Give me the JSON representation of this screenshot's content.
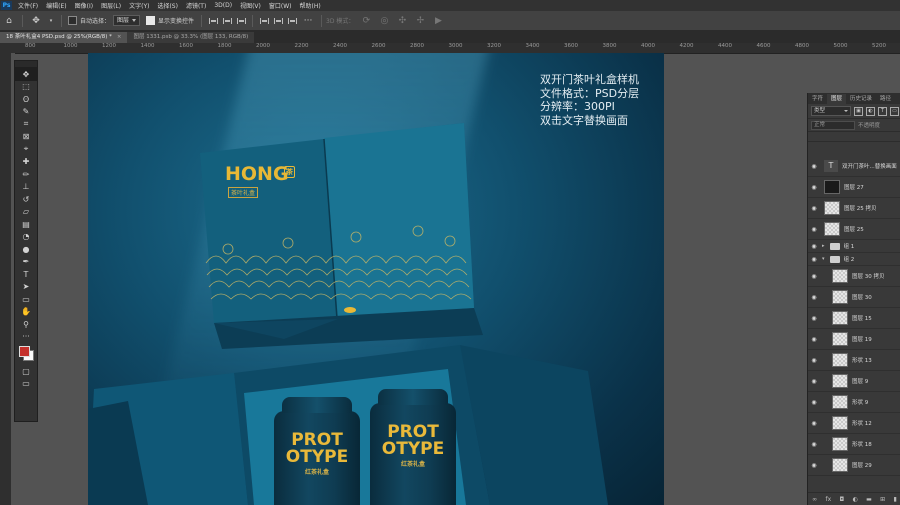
{
  "menubar": {
    "logo": "Ps",
    "items": [
      "文件(F)",
      "编辑(E)",
      "图像(I)",
      "图层(L)",
      "文字(Y)",
      "选择(S)",
      "滤镜(T)",
      "3D(D)",
      "视图(V)",
      "窗口(W)",
      "帮助(H)"
    ]
  },
  "options": {
    "auto_select_label": "自动选择：",
    "target_select": "图层",
    "show_transform_label": "显示变换控件",
    "mode_3d_label": "3D 模式："
  },
  "tabs": [
    {
      "label": "18 茶叶礼盒4 PSD.psd @ 25%(RGB/8) *",
      "close": "×"
    },
    {
      "label": "图层 1331.psb @ 33.3% (图层 133, RGB/8)",
      "close": ""
    }
  ],
  "ruler": {
    "ticks": [
      "800",
      "1000",
      "1200",
      "1400",
      "1600",
      "1800",
      "2000",
      "2200",
      "2400",
      "2600",
      "2800",
      "3000",
      "3200",
      "3400",
      "3600",
      "3800",
      "4000",
      "4200",
      "4400",
      "4600",
      "4800",
      "5000",
      "5200"
    ]
  },
  "toolbar": {
    "tools": [
      "move-tool",
      "marquee-tool",
      "lasso-tool",
      "quick-select-tool",
      "crop-tool",
      "frame-tool",
      "eyedropper-tool",
      "healing-tool",
      "brush-tool",
      "stamp-tool",
      "history-brush-tool",
      "eraser-tool",
      "gradient-tool",
      "blur-tool",
      "dodge-tool",
      "pen-tool",
      "type-tool",
      "path-select-tool",
      "rectangle-tool",
      "hand-tool",
      "zoom-tool",
      "more-tools"
    ],
    "foreground_color": "#c4302b",
    "background_color": "#fafafa"
  },
  "canvas": {
    "info_lines": [
      "双开门茶叶礼盒样机",
      "文件格式：PSD分层",
      "分辨率：300PI",
      "双击文字替换画面"
    ],
    "box_brand": "HONG",
    "box_badge": "茶",
    "box_subbrand": "茶叶礼盒",
    "can_line1": "PROT",
    "can_line2": "OTYPE",
    "can_badge": "茶",
    "can_subtext": "红茶礼盒",
    "accent_color": "#e8b836",
    "bg_color": "#0e4b66"
  },
  "layers_panel": {
    "tabs": [
      "字符",
      "图层",
      "历史记录",
      "路径"
    ],
    "filter_kind": "类型",
    "blend_mode": "正常",
    "opacity_label": "不透明度",
    "layers": [
      {
        "name": "双开门茶叶...替换画面",
        "thumb": "text",
        "type": "layer"
      },
      {
        "name": "图层 27",
        "thumb": "dark",
        "type": "layer"
      },
      {
        "name": "图层 25 拷贝",
        "thumb": "checker",
        "type": "layer"
      },
      {
        "name": "图层 25",
        "thumb": "checker",
        "type": "layer"
      },
      {
        "name": "组 1",
        "thumb": "folder",
        "type": "group"
      },
      {
        "name": "组 2",
        "thumb": "folder",
        "type": "group"
      },
      {
        "name": "图层 30 拷贝",
        "thumb": "checker",
        "type": "layer"
      },
      {
        "name": "图层 30",
        "thumb": "checker",
        "type": "layer"
      },
      {
        "name": "图层 15",
        "thumb": "checker",
        "type": "layer"
      },
      {
        "name": "图层 19",
        "thumb": "checker",
        "type": "layer"
      },
      {
        "name": "形状 13",
        "thumb": "checker",
        "type": "layer"
      },
      {
        "name": "图层 9",
        "thumb": "checker",
        "type": "layer"
      },
      {
        "name": "形状 9",
        "thumb": "checker",
        "type": "layer"
      },
      {
        "name": "形状 12",
        "thumb": "checker",
        "type": "layer"
      },
      {
        "name": "形状 18",
        "thumb": "checker",
        "type": "layer"
      },
      {
        "name": "图层 29",
        "thumb": "checker",
        "type": "layer"
      }
    ],
    "footer_icons": [
      "link-icon",
      "fx-icon",
      "mask-icon",
      "adjustment-icon",
      "folder-icon",
      "new-layer-icon",
      "trash-icon"
    ]
  }
}
